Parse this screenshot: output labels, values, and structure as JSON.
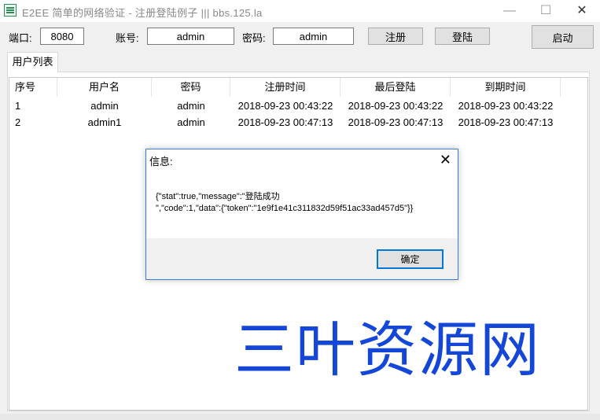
{
  "window": {
    "title": "E2EE 简单的网络验证  -  注册登陆例子     |||    bbs.125.la",
    "minimize_glyph": "—",
    "maximize_glyph": "☐",
    "close_glyph": "✕"
  },
  "toolbar": {
    "port_label": "端口:",
    "port_value": "8080",
    "account_label": "账号:",
    "account_value": "admin",
    "password_label": "密码:",
    "password_value": "admin",
    "register_label": "注册",
    "login_label": "登陆",
    "start_label": "启动"
  },
  "tabs": [
    {
      "label": "用户列表",
      "selected": true
    }
  ],
  "table": {
    "columns": [
      "序号",
      "用户名",
      "密码",
      "注册时间",
      "最后登陆",
      "到期时间"
    ],
    "rows": [
      [
        "1",
        "admin",
        "admin",
        "2018-09-23 00:43:22",
        "2018-09-23 00:43:22",
        "2018-09-23 00:43:22"
      ],
      [
        "2",
        "admin1",
        "admin",
        "2018-09-23 00:47:13",
        "2018-09-23 00:47:13",
        "2018-09-23 00:47:13"
      ]
    ]
  },
  "dialog": {
    "title": "信息:",
    "close_glyph": "✕",
    "message": "{\"stat\":true,\"message\":\"登陆成功\n\",\"code\":1,\"data\":{\"token\":\"1e9f1e41c311832d59f51ac33ad457d5\"}}",
    "ok_label": "确定"
  },
  "watermark": "三叶资源网",
  "colors": {
    "accent": "#0078d7",
    "dialog_border": "#3c7fd8",
    "watermark": "#1446d8",
    "window_bg": "#f0f0f0"
  }
}
